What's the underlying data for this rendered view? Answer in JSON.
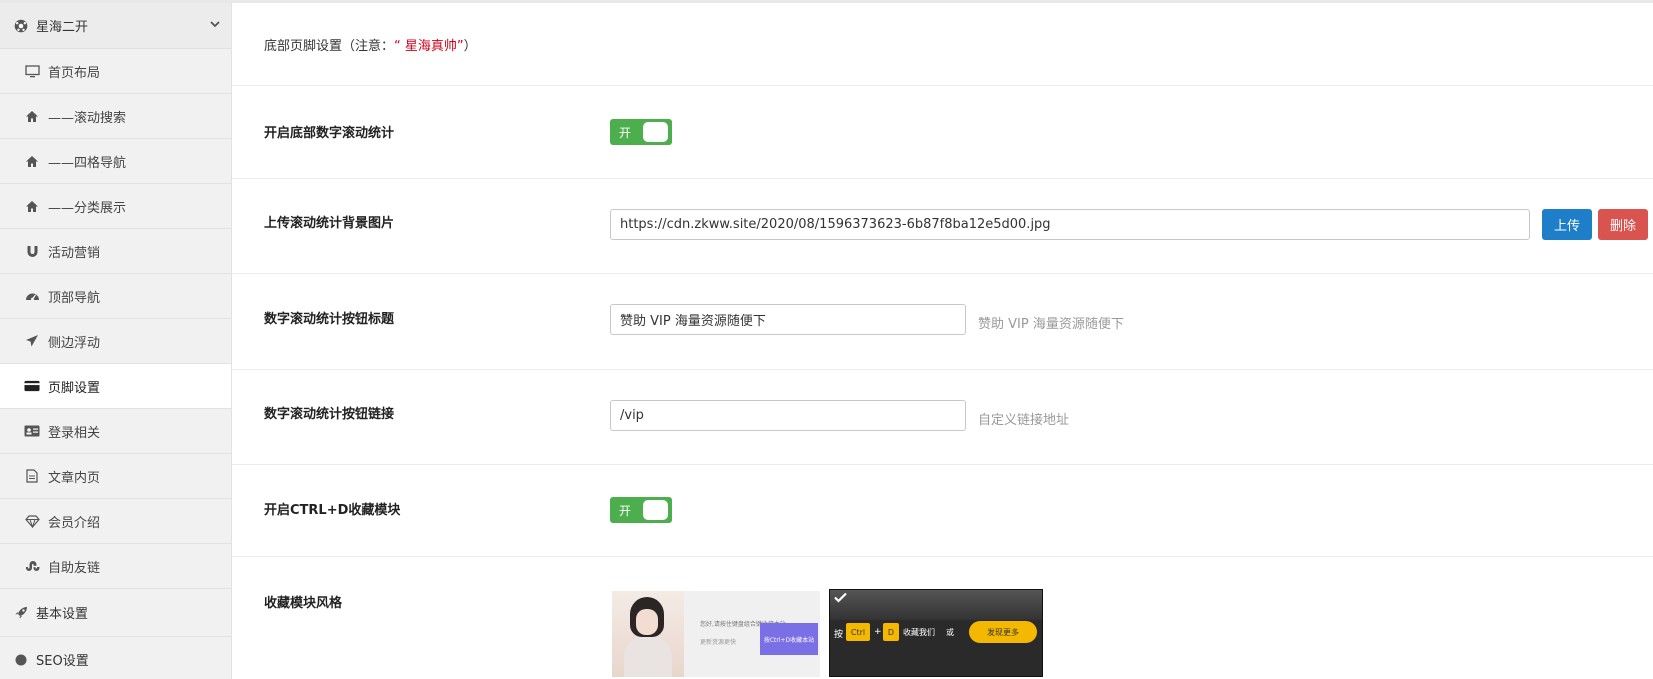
{
  "sidebar": {
    "group_top": {
      "label": "星海二开",
      "icon": "soccer-ball-icon"
    },
    "items": [
      {
        "label": "首页布局",
        "icon": "desktop-icon"
      },
      {
        "label": "——滚动搜索",
        "icon": "home-icon"
      },
      {
        "label": "——四格导航",
        "icon": "home-icon"
      },
      {
        "label": "——分类展示",
        "icon": "home-icon"
      },
      {
        "label": "活动营销",
        "icon": "magnet-icon"
      },
      {
        "label": "顶部导航",
        "icon": "dashboard-icon"
      },
      {
        "label": "侧边浮动",
        "icon": "send-icon"
      },
      {
        "label": "页脚设置",
        "icon": "credit-card-icon",
        "active": true
      },
      {
        "label": "登录相关",
        "icon": "id-card-icon"
      },
      {
        "label": "文章内页",
        "icon": "file-icon"
      },
      {
        "label": "会员介绍",
        "icon": "diamond-icon"
      },
      {
        "label": "自助友链",
        "icon": "stumbleupon-icon"
      }
    ],
    "group_basic": {
      "label": "基本设置",
      "icon": "rocket-icon"
    },
    "group_seo": {
      "label": "SEO设置",
      "icon": "circle-icon"
    }
  },
  "main": {
    "title": {
      "prefix": "底部页脚设置（注意：",
      "highlight": "“ 星海真帅”",
      "suffix": "）"
    },
    "rows": {
      "scroll_stat": {
        "label": "开启底部数字滚动统计",
        "toggle": "开"
      },
      "bg_image": {
        "label": "上传滚动统计背景图片",
        "value": "https://cdn.zkww.site/2020/08/1596373623-6b87f8ba12e5d00.jpg",
        "upload": "上传",
        "delete": "删除"
      },
      "btn_title": {
        "label": "数字滚动统计按钮标题",
        "value": "赞助 VIP 海量资源随便下",
        "hint": "赞助 VIP 海量资源随便下"
      },
      "btn_link": {
        "label": "数字滚动统计按钮链接",
        "value": "/vip",
        "hint": "自定义链接地址"
      },
      "ctrl_d": {
        "label": "开启CTRL+D收藏模块",
        "toggle": "开"
      },
      "style": {
        "label": "收藏模块风格",
        "thumb1": {
          "line1": "您好,请按住键盘组合键收藏本站",
          "line2": "更新资源更快",
          "button": "按Ctrl+D收藏本站"
        },
        "thumb2": {
          "press": "按",
          "ctrl": "Ctrl",
          "plus": "+",
          "d": "D",
          "collect": "收藏我们",
          "or": "或",
          "button": "发现更多"
        }
      }
    }
  }
}
